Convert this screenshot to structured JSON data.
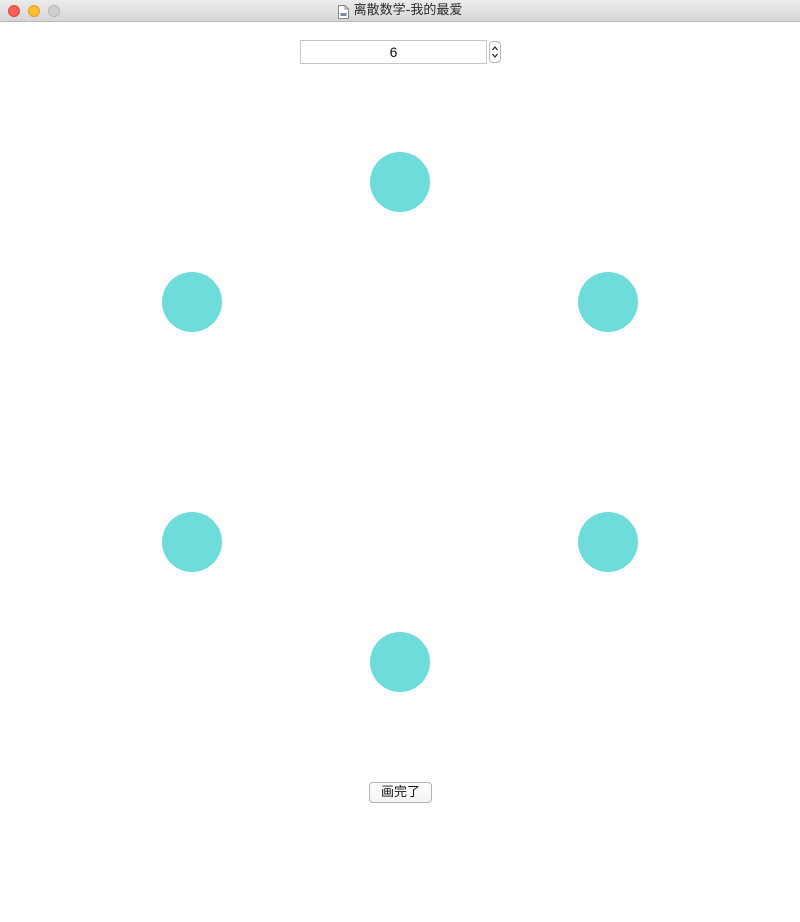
{
  "window": {
    "title": "离散数学-我的最爱"
  },
  "stepper": {
    "value": "6"
  },
  "graph": {
    "node_color": "#6fdcdc",
    "node_count": 6
  },
  "actions": {
    "done_label": "画完了"
  },
  "icons": {
    "document": "document-icon",
    "stepper_up": "chevron-up-icon",
    "stepper_down": "chevron-down-icon"
  }
}
